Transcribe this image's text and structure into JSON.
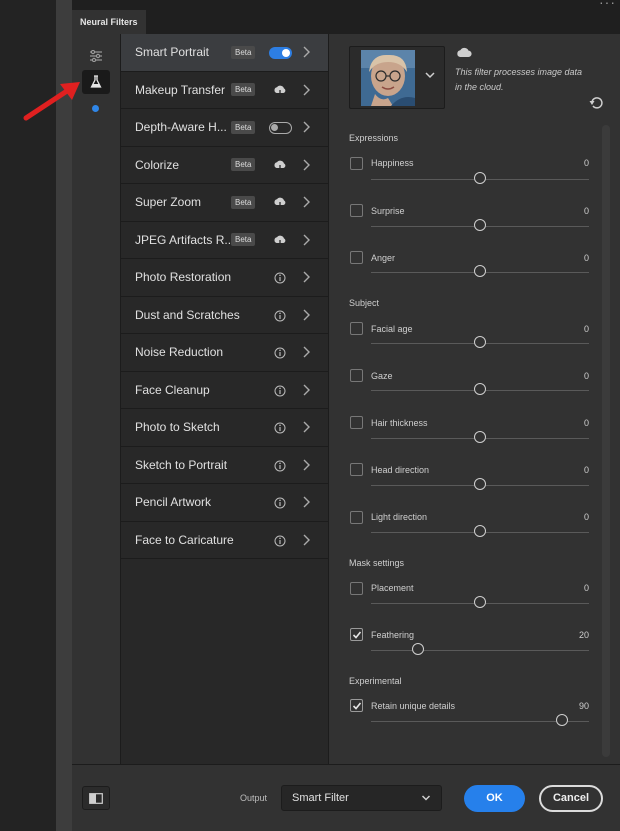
{
  "tab": {
    "title": "Neural Filters"
  },
  "filters": [
    {
      "name": "Smart Portrait",
      "beta": "Beta",
      "status": "toggle-on",
      "selected": true
    },
    {
      "name": "Makeup Transfer",
      "beta": "Beta",
      "status": "cloud-download"
    },
    {
      "name": "Depth-Aware H...",
      "beta": "Beta",
      "status": "toggle-off"
    },
    {
      "name": "Colorize",
      "beta": "Beta",
      "status": "cloud-download"
    },
    {
      "name": "Super Zoom",
      "beta": "Beta",
      "status": "cloud-download"
    },
    {
      "name": "JPEG Artifacts R...",
      "beta": "Beta",
      "status": "cloud-download"
    },
    {
      "name": "Photo Restoration",
      "status": "info"
    },
    {
      "name": "Dust and Scratches",
      "status": "info"
    },
    {
      "name": "Noise Reduction",
      "status": "info"
    },
    {
      "name": "Face Cleanup",
      "status": "info"
    },
    {
      "name": "Photo to Sketch",
      "status": "info"
    },
    {
      "name": "Sketch to Portrait",
      "status": "info"
    },
    {
      "name": "Pencil Artwork",
      "status": "info"
    },
    {
      "name": "Face to Caricature",
      "status": "info"
    }
  ],
  "panel": {
    "cloud_note": "This filter processes image data in the cloud.",
    "expressions": {
      "title": "Expressions",
      "rows": [
        {
          "label": "Happiness",
          "value": "0",
          "checked": false,
          "level": 0.5
        },
        {
          "label": "Surprise",
          "value": "0",
          "checked": false,
          "level": 0.5
        },
        {
          "label": "Anger",
          "value": "0",
          "checked": false,
          "level": 0.5
        }
      ]
    },
    "subject": {
      "title": "Subject",
      "rows": [
        {
          "label": "Facial age",
          "value": "0",
          "checked": false,
          "level": 0.5
        },
        {
          "label": "Gaze",
          "value": "0",
          "checked": false,
          "level": 0.5
        },
        {
          "label": "Hair thickness",
          "value": "0",
          "checked": false,
          "level": 0.5
        },
        {
          "label": "Head direction",
          "value": "0",
          "checked": false,
          "level": 0.5
        },
        {
          "label": "Light direction",
          "value": "0",
          "checked": false,
          "level": 0.5
        }
      ]
    },
    "mask": {
      "title": "Mask settings",
      "rows": [
        {
          "label": "Placement",
          "value": "0",
          "checked": false,
          "level": 0.5
        },
        {
          "label": "Feathering",
          "value": "20",
          "checked": true,
          "level": 0.2
        }
      ]
    },
    "experimental": {
      "title": "Experimental",
      "rows": [
        {
          "label": "Retain unique details",
          "value": "90",
          "checked": true,
          "level": 0.9
        }
      ]
    }
  },
  "footer": {
    "output_label": "Output",
    "output_value": "Smart Filter",
    "ok_label": "OK",
    "cancel_label": "Cancel"
  },
  "colors": {
    "accent": "#2680eb",
    "arrow": "#e02020"
  }
}
